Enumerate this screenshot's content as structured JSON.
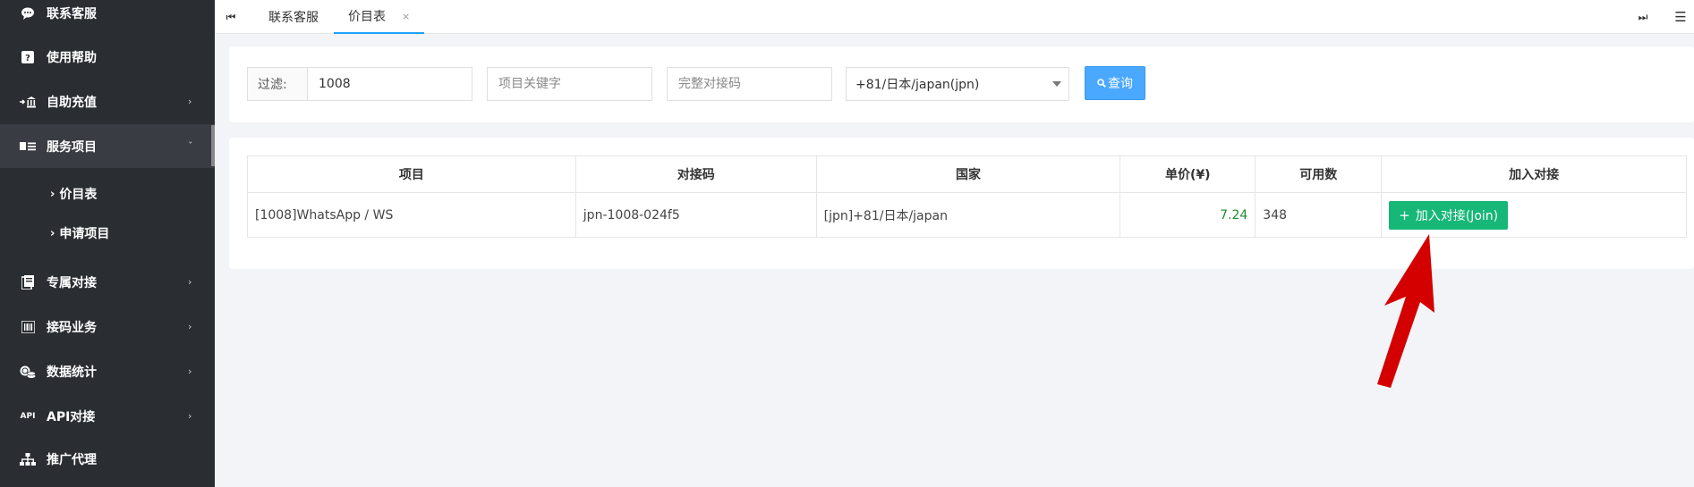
{
  "sidebar": {
    "items": [
      {
        "label": "联系客服"
      },
      {
        "label": "使用帮助"
      },
      {
        "label": "自助充值"
      },
      {
        "label": "服务项目"
      },
      {
        "label": "专属对接"
      },
      {
        "label": "接码业务"
      },
      {
        "label": "数据统计"
      },
      {
        "label": "API对接",
        "icon_text": "API"
      },
      {
        "label": "推广代理"
      }
    ],
    "subitems": [
      {
        "label": "价目表"
      },
      {
        "label": "申请项目"
      }
    ]
  },
  "tabs": [
    {
      "label": "联系客服"
    },
    {
      "label": "价目表",
      "close": "×"
    }
  ],
  "filter": {
    "label": "过滤:",
    "value": "1008",
    "keyword_placeholder": "项目关键字",
    "code_placeholder": "完整对接码",
    "country_selected": "+81/日本/japan(jpn)",
    "query_label": "查询"
  },
  "table": {
    "headers": [
      "项目",
      "对接码",
      "国家",
      "单价(¥)",
      "可用数",
      "加入对接"
    ],
    "rows": [
      {
        "project": "[1008]WhatsApp / WS",
        "code": "jpn-1008-024f5",
        "country": "[jpn]+81/日本/japan",
        "price": "7.24",
        "available": "348",
        "join_label": "加入对接(Join)"
      }
    ]
  },
  "colors": {
    "sidebar_bg": "#2a2d32",
    "query_btn": "#4aa8ff",
    "join_btn": "#16b777",
    "price": "#1f8c2d",
    "annotation_arrow": "#d40000"
  }
}
